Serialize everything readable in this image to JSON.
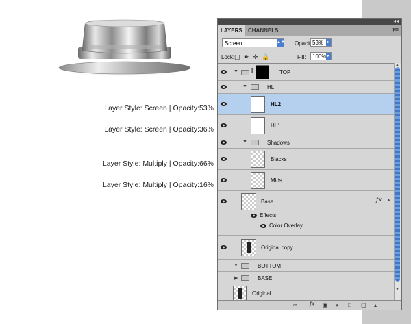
{
  "annotations": [
    "Layer Style: Screen | Opacity:53%",
    "Layer Style: Screen | Opacity:36%",
    "Layer Style: Multiply | Opacity:66%",
    "Layer Style: Multiply | Opacity:16%"
  ],
  "panel": {
    "tabs": [
      "LAYERS",
      "CHANNELS"
    ],
    "blend_mode": "Screen",
    "opacity_label": "Opacity:",
    "opacity_value": "53%",
    "lock_label": "Lock:",
    "fill_label": "Fill:",
    "fill_value": "100%",
    "layers": [
      {
        "name": "TOP",
        "visible": true,
        "type": "group-mask",
        "expanded": true
      },
      {
        "name": "HL",
        "visible": true,
        "type": "folder",
        "expanded": true
      },
      {
        "name": "HL2",
        "visible": true,
        "type": "layer",
        "selected": true
      },
      {
        "name": "HL1",
        "visible": true,
        "type": "layer"
      },
      {
        "name": "Shadows",
        "visible": true,
        "type": "folder",
        "expanded": true
      },
      {
        "name": "Blacks",
        "visible": true,
        "type": "layer"
      },
      {
        "name": "Mids",
        "visible": true,
        "type": "layer"
      },
      {
        "name": "Base",
        "visible": true,
        "type": "layer",
        "has_fx": true
      },
      {
        "name": "Effects",
        "visible": true,
        "type": "effects"
      },
      {
        "name": "Color Overlay",
        "visible": true,
        "type": "effect-item"
      },
      {
        "name": "Original copy",
        "visible": true,
        "type": "layer"
      },
      {
        "name": "BOTTOM",
        "visible": false,
        "type": "folder",
        "expanded": true
      },
      {
        "name": "BASE",
        "visible": false,
        "type": "folder",
        "expanded": false
      },
      {
        "name": "Original",
        "visible": false,
        "type": "layer"
      }
    ],
    "fx_symbol": "fx"
  },
  "colors": {
    "selection": "#b5d0ee",
    "accent": "#4b7ed1"
  }
}
